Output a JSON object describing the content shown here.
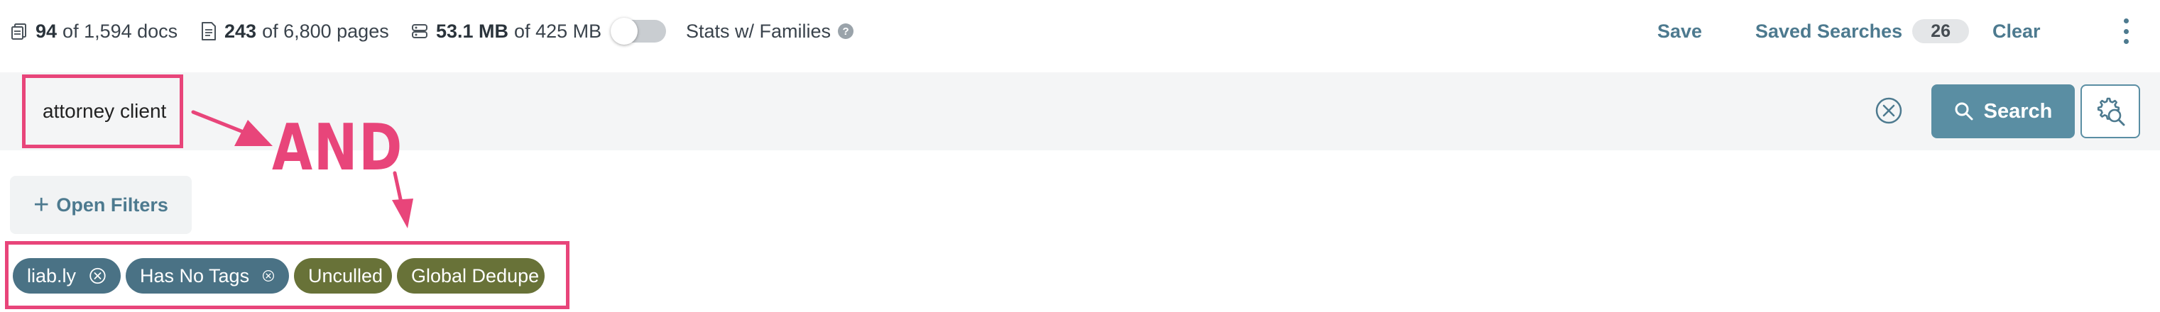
{
  "stats": {
    "docs_count": "94",
    "docs_total": "of 1,594 docs",
    "pages_count": "243",
    "pages_total": "of 6,800 pages",
    "size_count": "53.1 MB",
    "size_total": "of 425 MB",
    "families_label": "Stats w/ Families",
    "families_enabled": false
  },
  "toolbar": {
    "save_label": "Save",
    "saved_searches_label": "Saved Searches",
    "saved_searches_count": "26",
    "clear_label": "Clear"
  },
  "search": {
    "query": "attorney client",
    "button_label": "Search"
  },
  "filters": {
    "open_filters_label": "Open Filters",
    "chips": [
      {
        "label": "liab.ly",
        "removable": true,
        "color": "#4a7285"
      },
      {
        "label": "Has No Tags",
        "removable": true,
        "color": "#4a7285"
      },
      {
        "label": "Unculled",
        "removable": false,
        "color": "#687238"
      },
      {
        "label": "Global Dedupe",
        "removable": false,
        "color": "#687238"
      }
    ]
  },
  "annotation": {
    "operator_text": "AND",
    "color": "#e8457a"
  },
  "colors": {
    "accent": "#5a8ea3",
    "link": "#4d7a8f"
  }
}
